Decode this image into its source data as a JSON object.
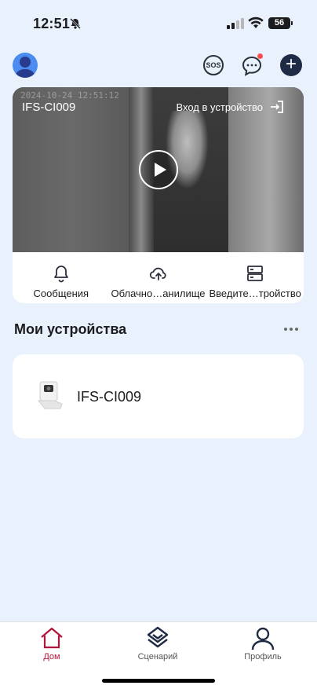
{
  "status_bar": {
    "time": "12:51",
    "battery": "56"
  },
  "camera": {
    "timestamp": "2024-10-24 12:51:12",
    "name": "IFS-CI009",
    "enter_device": "Вход в устройство",
    "actions": [
      {
        "label": "Сообщения",
        "icon": "bell-icon"
      },
      {
        "label": "Облачно…анилище",
        "icon": "cloud-upload-icon"
      },
      {
        "label": "Введите…тройство",
        "icon": "server-icon"
      }
    ]
  },
  "header": {
    "sos": "SOS"
  },
  "devices": {
    "title": "Мои устройства",
    "items": [
      {
        "name": "IFS-CI009",
        "icon": "camera-device-icon"
      }
    ]
  },
  "tabs": [
    {
      "label": "Дом",
      "icon": "home-icon",
      "active": true
    },
    {
      "label": "Сценарий",
      "icon": "scenario-icon",
      "active": false
    },
    {
      "label": "Профиль",
      "icon": "profile-icon",
      "active": false
    }
  ],
  "colors": {
    "accent": "#b0153a",
    "background": "#e8f1fc",
    "dark": "#1f2a44",
    "badge": "#ff4d4f"
  }
}
